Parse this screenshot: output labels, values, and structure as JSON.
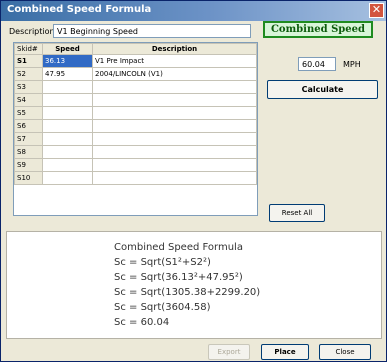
{
  "window": {
    "title": "Combined Speed Formula",
    "close_label": "✕"
  },
  "description": {
    "label": "Description:",
    "value": "V1 Beginning Speed"
  },
  "result": {
    "header": "Combined Speed",
    "speed_value": "60.04",
    "unit": "MPH"
  },
  "buttons": {
    "calculate": "Calculate",
    "reset_all": "Reset All",
    "export": "Export",
    "place": "Place",
    "close": "Close"
  },
  "grid": {
    "headers": [
      "Skid#",
      "Speed",
      "Description"
    ],
    "rows": [
      {
        "skid": "S1",
        "speed": "36.13",
        "description": "V1 Pre Impact"
      },
      {
        "skid": "S2",
        "speed": "47.95",
        "description": "2004/LINCOLN (V1)"
      },
      {
        "skid": "S3",
        "speed": "",
        "description": ""
      },
      {
        "skid": "S4",
        "speed": "",
        "description": ""
      },
      {
        "skid": "S5",
        "speed": "",
        "description": ""
      },
      {
        "skid": "S6",
        "speed": "",
        "description": ""
      },
      {
        "skid": "S7",
        "speed": "",
        "description": ""
      },
      {
        "skid": "S8",
        "speed": "",
        "description": ""
      },
      {
        "skid": "S9",
        "speed": "",
        "description": ""
      },
      {
        "skid": "S10",
        "speed": "",
        "description": ""
      }
    ]
  },
  "formula": {
    "lines": [
      "Combined Speed Formula",
      "Sc = Sqrt(S1²+S2²)",
      "Sc = Sqrt(36.13²+47.95²)",
      "Sc = Sqrt(1305.38+2299.20)",
      "Sc = Sqrt(3604.58)",
      "Sc = 60.04"
    ]
  },
  "colors": {
    "title_bar": "#3a6ea5",
    "accent_green": "#1f8b1f",
    "selection": "#316ac5"
  }
}
